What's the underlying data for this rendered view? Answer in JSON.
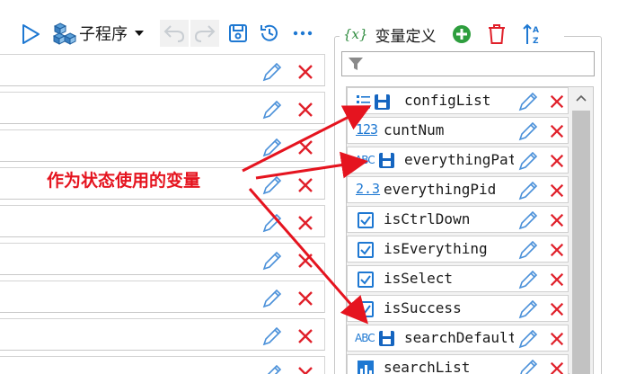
{
  "toolbar": {
    "subroutine_label": "子程序"
  },
  "var_panel": {
    "title": "变量定义",
    "title_icon_text": "{x}"
  },
  "variables": [
    {
      "name": "configList",
      "type_icon": "list-save-icon"
    },
    {
      "name": "cuntNum",
      "type_icon": "integer-123-icon"
    },
    {
      "name": "everythingPat",
      "type_icon": "string-abc-save-icon"
    },
    {
      "name": "everythingPid",
      "type_icon": "decimal-2.3-icon"
    },
    {
      "name": "isCtrlDown",
      "type_icon": "checkbox-icon"
    },
    {
      "name": "isEverything",
      "type_icon": "checkbox-icon"
    },
    {
      "name": "isSelect",
      "type_icon": "checkbox-icon"
    },
    {
      "name": "isSuccess",
      "type_icon": "checkbox-icon"
    },
    {
      "name": "searchDefault",
      "type_icon": "string-abc-save-icon"
    },
    {
      "name": "searchList",
      "type_icon": "data-table-icon"
    }
  ],
  "type_icon_text": {
    "integer": "123",
    "decimal": "2.3",
    "string": "ABC"
  },
  "annotation": {
    "text": "作为状态使用的变量"
  },
  "colors": {
    "accent_blue": "#1565c0",
    "icon_blue": "#1e78d2",
    "delete_red": "#e0202a",
    "annotation_red": "#e5141f",
    "add_green": "#2e9e3e"
  }
}
